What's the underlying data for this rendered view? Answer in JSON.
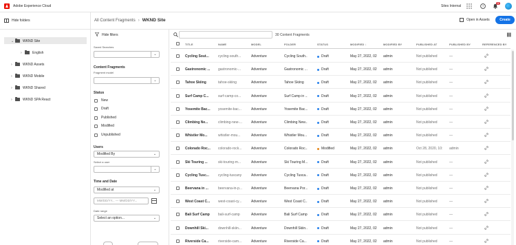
{
  "app": {
    "title": "Adobe Experience Cloud",
    "org": "Sites Internal",
    "notification_count": "5"
  },
  "header": {
    "hide_folders_label": "Hide folders",
    "breadcrumb_root": "All Content Fragments",
    "breadcrumb_separator": "›",
    "breadcrumb_current": "WKND Site",
    "open_in_assets_label": "Open in Assets",
    "create_label": "Create"
  },
  "folders": [
    {
      "label": "WKND Site",
      "expanded": true,
      "selected": true
    },
    {
      "label": "English",
      "child": true
    },
    {
      "label": "WKND Assets"
    },
    {
      "label": "WKND Mobile"
    },
    {
      "label": "WKND Shared"
    },
    {
      "label": "WKND SPA React"
    }
  ],
  "filters": {
    "hide_filters_label": "Hide filters",
    "saved_searches_label": "Saved Searches",
    "content_fragments_heading": "Content Fragments",
    "fragment_model_label": "Fragment model",
    "status_heading": "Status",
    "status_options": [
      "New",
      "Draft",
      "Published",
      "Modified",
      "Unpublished"
    ],
    "users_heading": "Users",
    "users_select": "Modified By",
    "select_user_label": "Select a user",
    "time_date_heading": "Time and Date",
    "time_select": "Modified at",
    "date_range_placeholder": "MM/DD/YY... — MM/DD/YY...",
    "date_range_label": "Date range",
    "date_range_select": "Select an option..."
  },
  "table": {
    "count_text": "30 Content Fragments",
    "columns": [
      "TITLE",
      "NAME",
      "MODEL",
      "FOLDER",
      "STATUS",
      "MODIFIED ↓",
      "MODIFIED BY",
      "PUBLISHED AT",
      "PUBLISHED BY",
      "REFERENCED BY"
    ],
    "rows": [
      {
        "title": "Cycling Sout...",
        "name": "cycling-south...",
        "model": "Adventure",
        "folder": "Cycling South...",
        "status": "Draft",
        "modified": "May 27, 2022, 02",
        "modified_by": "admin",
        "published_at": "Not published",
        "published_by": "—"
      },
      {
        "title": "Gastronomic ...",
        "name": "gastronomic-...",
        "model": "Adventure",
        "folder": "Gastronomic ...",
        "status": "Draft",
        "modified": "May 27, 2022, 02",
        "modified_by": "admin",
        "published_at": "Not published",
        "published_by": "—"
      },
      {
        "title": "Tahoe Skiing",
        "name": "tahoe-skiing",
        "model": "Adventure",
        "folder": "Tahoe Skiing",
        "status": "Draft",
        "modified": "May 27, 2022, 02",
        "modified_by": "admin",
        "published_at": "Not published",
        "published_by": "—"
      },
      {
        "title": "Surf Camp C...",
        "name": "surf-camp-co...",
        "model": "Adventure",
        "folder": "Surf Camp in ...",
        "status": "Draft",
        "modified": "May 27, 2022, 02",
        "modified_by": "admin",
        "published_at": "Not published",
        "published_by": "—"
      },
      {
        "title": "Yosemite Bac...",
        "name": "yosemite-bac...",
        "model": "Adventure",
        "folder": "Yosemite Bac...",
        "status": "Draft",
        "modified": "May 27, 2022, 02",
        "modified_by": "admin",
        "published_at": "Not published",
        "published_by": "—"
      },
      {
        "title": "Climbing Ne...",
        "name": "climbing-new-...",
        "model": "Adventure",
        "folder": "Climbing New...",
        "status": "Draft",
        "modified": "May 27, 2022, 02",
        "modified_by": "admin",
        "published_at": "Not published",
        "published_by": "—"
      },
      {
        "title": "Whistler Mo...",
        "name": "whistler-mou...",
        "model": "Adventure",
        "folder": "Whistler Mou...",
        "status": "Draft",
        "modified": "May 27, 2022, 02",
        "modified_by": "admin",
        "published_at": "Not published",
        "published_by": "—"
      },
      {
        "title": "Colorado Roc...",
        "name": "colorado-rock...",
        "model": "Adventure",
        "folder": "Colorado Roc...",
        "status": "Modified",
        "modified": "May 27, 2022, 02",
        "modified_by": "admin",
        "published_at": "Oct 28, 2020, 10:",
        "published_by": "admin"
      },
      {
        "title": "Ski Touring ...",
        "name": "ski-touring-m...",
        "model": "Adventure",
        "folder": "Ski Touring M...",
        "status": "Draft",
        "modified": "May 27, 2022, 02",
        "modified_by": "admin",
        "published_at": "Not published",
        "published_by": "—"
      },
      {
        "title": "Cycling Tusc...",
        "name": "cycling-tuscany",
        "model": "Adventure",
        "folder": "Cycling Tusca...",
        "status": "Draft",
        "modified": "May 27, 2022, 02",
        "modified_by": "admin",
        "published_at": "Not published",
        "published_by": "—"
      },
      {
        "title": "Beervana in ...",
        "name": "beervana-in-p...",
        "model": "Adventure",
        "folder": "Beervana Por...",
        "status": "Draft",
        "modified": "May 27, 2022, 02",
        "modified_by": "admin",
        "published_at": "Not published",
        "published_by": "—"
      },
      {
        "title": "West Coast C...",
        "name": "west-coast-cy...",
        "model": "Adventure",
        "folder": "West Coast C...",
        "status": "Draft",
        "modified": "May 27, 2022, 02",
        "modified_by": "admin",
        "published_at": "Not published",
        "published_by": "—"
      },
      {
        "title": "Bali Surf Camp",
        "name": "bali-surf-camp",
        "model": "Adventure",
        "folder": "Bali Surf Camp",
        "status": "Draft",
        "modified": "May 27, 2022, 02",
        "modified_by": "admin",
        "published_at": "Not published",
        "published_by": "—"
      },
      {
        "title": "Downhill Ski...",
        "name": "downhill-skiin...",
        "model": "Adventure",
        "folder": "Downhill Skiin...",
        "status": "Draft",
        "modified": "May 27, 2022, 02",
        "modified_by": "admin",
        "published_at": "Not published",
        "published_by": "—"
      },
      {
        "title": "Riverside Ca...",
        "name": "riverside-cam...",
        "model": "Adventure",
        "folder": "Riverside Ca...",
        "status": "Draft",
        "modified": "May 27, 2022, 02",
        "modified_by": "admin",
        "published_at": "Not published",
        "published_by": "—"
      }
    ]
  },
  "colors": {
    "accent": "#1473e6",
    "brand": "#eb1000",
    "draft_dot": "#2680eb",
    "modified_dot": "#e68619"
  },
  "icons": {
    "adobe_logo": "adobe-logo",
    "apps": "grid-icon",
    "help": "help-icon",
    "bell": "bell-icon",
    "filter": "filter-icon",
    "search": "search-icon",
    "link": "link-icon",
    "view": "view-switch-icon"
  }
}
